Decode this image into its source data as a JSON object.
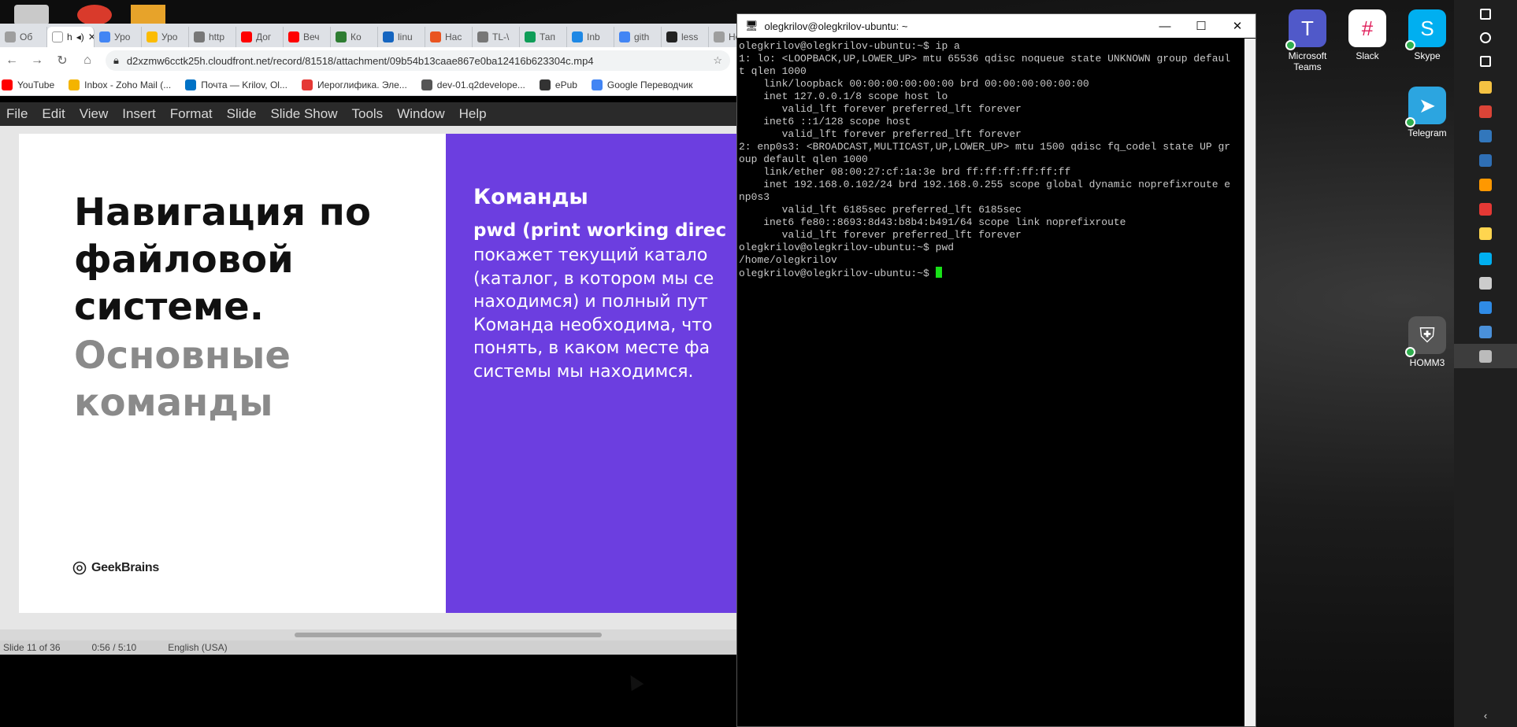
{
  "browser": {
    "tabs": [
      {
        "label": "Об",
        "color": "#9e9e9e"
      },
      {
        "label": "h",
        "color": "#ffffff",
        "active": true
      },
      {
        "label": "Уро",
        "color": "#4285f4"
      },
      {
        "label": "Уро",
        "color": "#fbbc04"
      },
      {
        "label": "http",
        "color": "#777777"
      },
      {
        "label": "Дог",
        "color": "#ff0000"
      },
      {
        "label": "Веч",
        "color": "#ff0000"
      },
      {
        "label": "Ко",
        "color": "#2e7d32"
      },
      {
        "label": "linu",
        "color": "#1565c0"
      },
      {
        "label": "Нас",
        "color": "#e95420"
      },
      {
        "label": "TL-\\",
        "color": "#777777"
      },
      {
        "label": "Тап",
        "color": "#0f9d58"
      },
      {
        "label": "Inb",
        "color": "#1e88e5"
      },
      {
        "label": "gith",
        "color": "#4285f4"
      },
      {
        "label": "less",
        "color": "#222222"
      },
      {
        "label": "Новая",
        "color": "#9e9e9e"
      }
    ],
    "url": "d2xzmw6cctk25h.cloudfront.net/record/81518/attachment/09b54b13caae867e0ba12416b623304c.mp4",
    "bookmarks": [
      {
        "label": "YouTube",
        "color": "#ff0000"
      },
      {
        "label": "Inbox - Zoho Mail (...",
        "color": "#f4b400"
      },
      {
        "label": "Почта — Krilov, Ol...",
        "color": "#0072c6"
      },
      {
        "label": "Иероглифика. Эле...",
        "color": "#e53935"
      },
      {
        "label": "dev-01.q2develope...",
        "color": "#555555"
      },
      {
        "label": "ePub",
        "color": "#333333"
      },
      {
        "label": "Google Переводчик",
        "color": "#4285f4"
      }
    ]
  },
  "video": {
    "menubar": [
      "File",
      "Edit",
      "View",
      "Insert",
      "Format",
      "Slide",
      "Slide Show",
      "Tools",
      "Window",
      "Help"
    ],
    "slide": {
      "title": "Навигация по файловой системе.",
      "subtitle": "Основные команды",
      "logo": "GeekBrains",
      "heading": "Команды",
      "bold_line": "pwd (print working direc",
      "body": "покажет текущий катало\n(каталог, в котором мы се\nнаходимся) и полный пут\nКоманда необходима, что\nпонять, в каком месте фа\nсистемы мы находимся."
    },
    "status": [
      "Slide 11 of 36",
      "0:56 / 5:10",
      "English (USA)"
    ]
  },
  "terminal": {
    "title": "olegkrilov@olegkrilov-ubuntu: ~",
    "output": "olegkrilov@olegkrilov-ubuntu:~$ ip a\n1: lo: <LOOPBACK,UP,LOWER_UP> mtu 65536 qdisc noqueue state UNKNOWN group defaul\nt qlen 1000\n    link/loopback 00:00:00:00:00:00 brd 00:00:00:00:00:00\n    inet 127.0.0.1/8 scope host lo\n       valid_lft forever preferred_lft forever\n    inet6 ::1/128 scope host\n       valid_lft forever preferred_lft forever\n2: enp0s3: <BROADCAST,MULTICAST,UP,LOWER_UP> mtu 1500 qdisc fq_codel state UP gr\noup default qlen 1000\n    link/ether 08:00:27:cf:1a:3e brd ff:ff:ff:ff:ff:ff\n    inet 192.168.0.102/24 brd 192.168.0.255 scope global dynamic noprefixroute e\nnp0s3\n       valid_lft 6185sec preferred_lft 6185sec\n    inet6 fe80::8693:8d43:b8b4:b491/64 scope link noprefixroute\n       valid_lft forever preferred_lft forever\nolegkrilov@olegkrilov-ubuntu:~$ pwd\n/home/olegkrilov\n",
    "prompt": "olegkrilov@olegkrilov-ubuntu:~$ "
  },
  "desktop": {
    "icons": [
      {
        "label": "Microsoft Teams",
        "color": "#5059c9",
        "glyph": "T"
      },
      {
        "label": "Slack",
        "color": "#ffffff",
        "glyph": "#"
      },
      {
        "label": "Skype",
        "color": "#00aff0",
        "glyph": "S"
      },
      {
        "label": "Telegram",
        "color": "#2ca5e0",
        "glyph": "➤"
      },
      {
        "label": "HOMM3",
        "color": "#555555",
        "glyph": "⛨"
      }
    ]
  },
  "taskbar": {
    "items": [
      {
        "name": "windows-start-icon",
        "color": "#ffffff"
      },
      {
        "name": "search-icon",
        "color": "#ffffff"
      },
      {
        "name": "task-view-icon",
        "color": "#ffffff"
      },
      {
        "name": "file-explorer-icon",
        "color": "#f5c242"
      },
      {
        "name": "chrome-icon",
        "color": "#db4437"
      },
      {
        "name": "edge-icon",
        "color": "#3277bc"
      },
      {
        "name": "virtualbox-icon",
        "color": "#2f6fb5"
      },
      {
        "name": "sublime-icon",
        "color": "#ff9800"
      },
      {
        "name": "chrome-profile-icon",
        "color": "#e53935"
      },
      {
        "name": "notepad-icon",
        "color": "#ffd54f"
      },
      {
        "name": "skype-icon",
        "color": "#00aff0"
      },
      {
        "name": "settings-icon",
        "color": "#cccccc"
      },
      {
        "name": "maps-icon",
        "color": "#2f8be6"
      },
      {
        "name": "photos-icon",
        "color": "#4a90d9"
      },
      {
        "name": "putty-icon",
        "color": "#bbbbbb"
      }
    ]
  }
}
